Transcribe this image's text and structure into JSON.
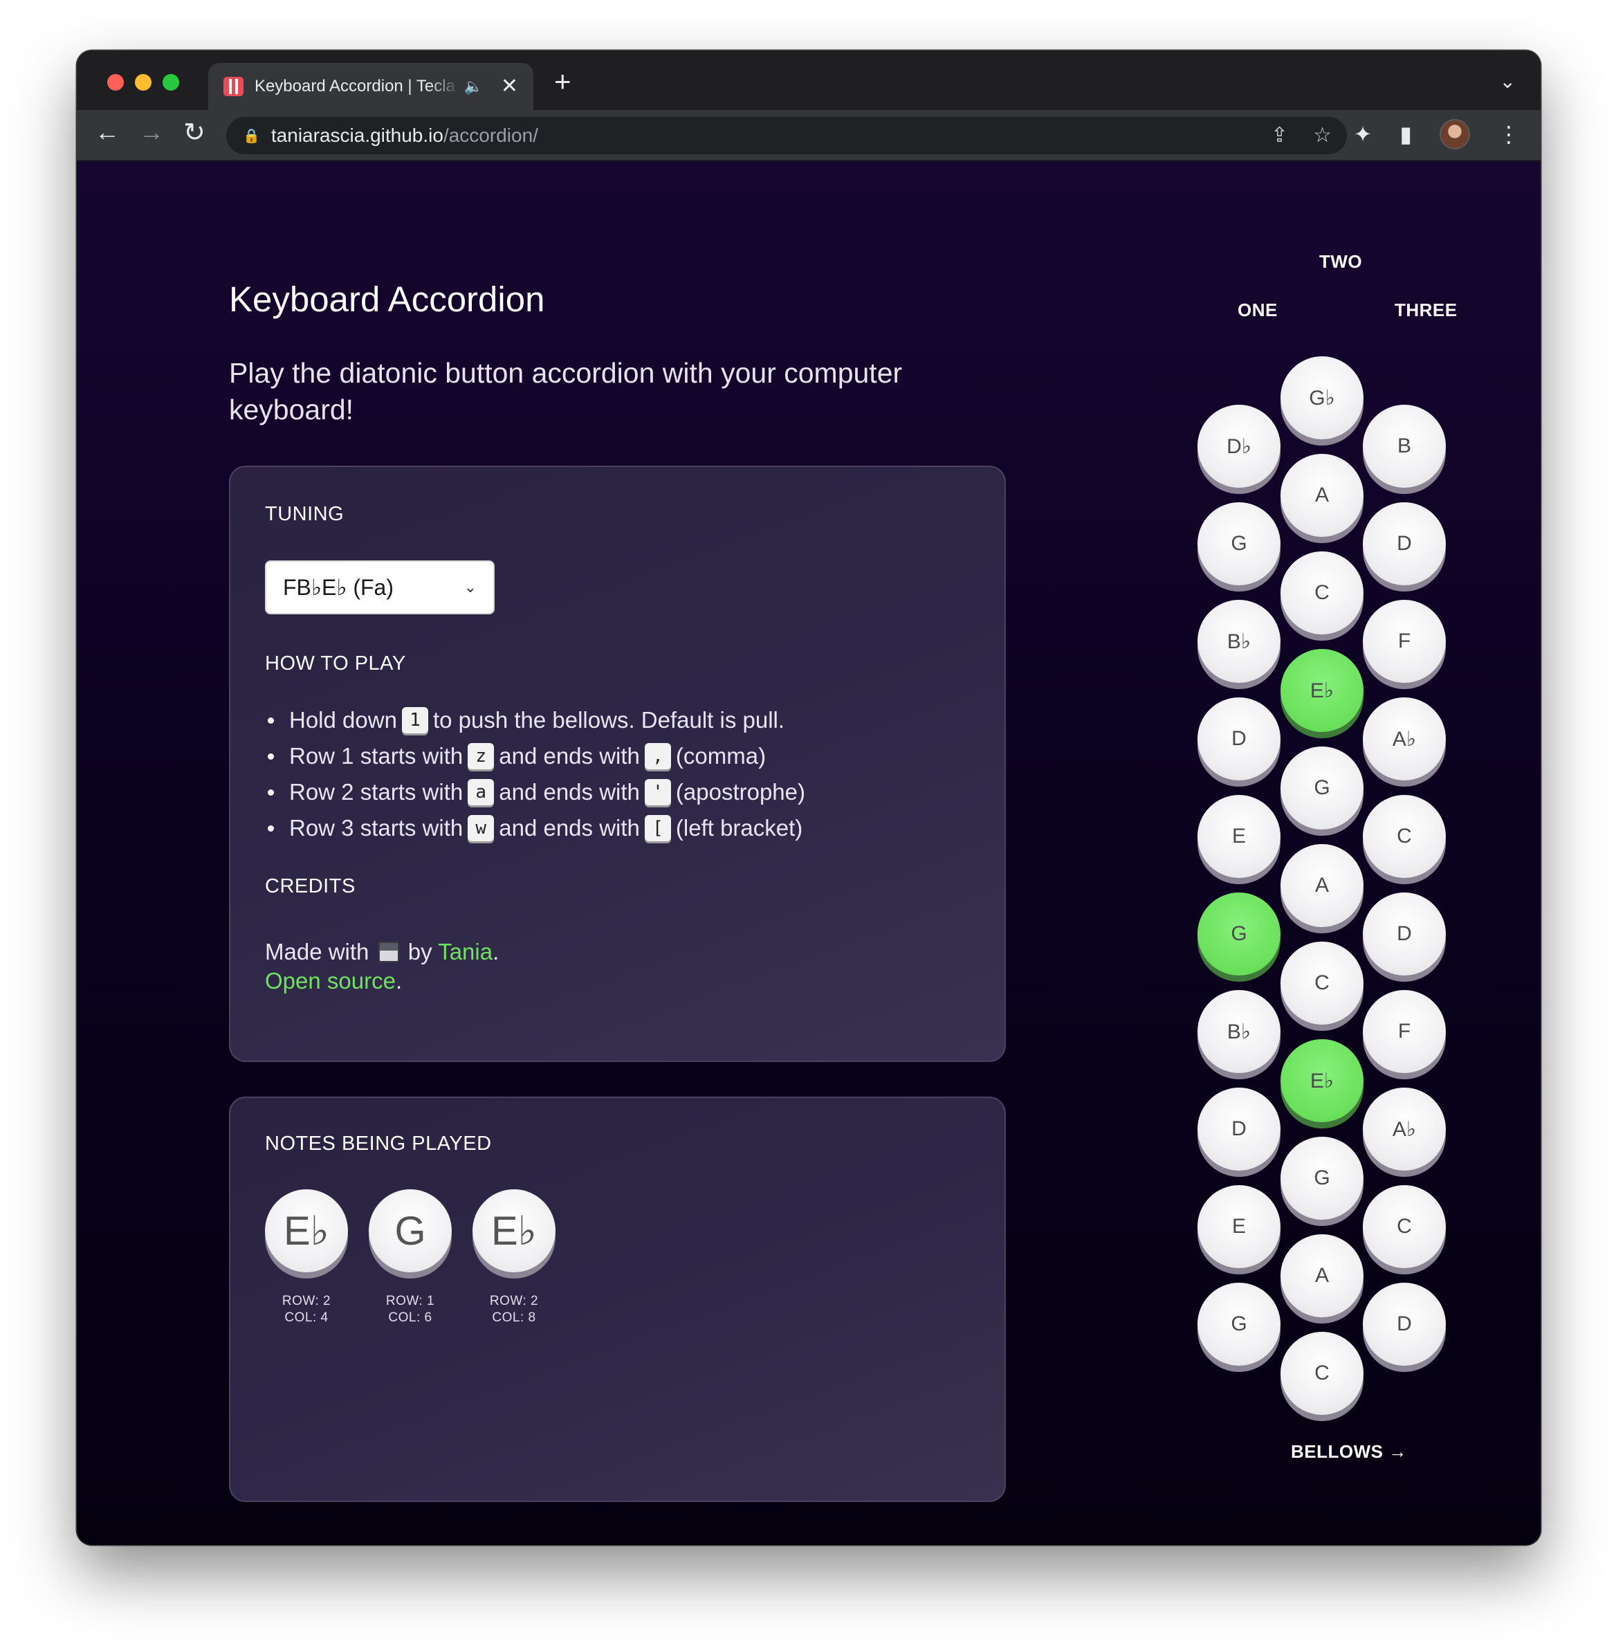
{
  "browser": {
    "tab_title": "Keyboard Accordion | Tecla",
    "tab_audio_icon": "speaker-icon",
    "tab_close": "✕",
    "new_tab": "+",
    "tab_list": "⌄",
    "url_host": "taniarascia.github.io",
    "url_path": "/accordion/"
  },
  "page": {
    "title": "Keyboard Accordion",
    "subtitle": "Play the diatonic button accordion with your computer keyboard!"
  },
  "tuning": {
    "heading": "TUNING",
    "selected": "FB♭E♭ (Fa)"
  },
  "how_to_play": {
    "heading": "HOW TO PLAY",
    "items": [
      {
        "before": "Hold down",
        "key": "1",
        "after": "to push the bellows. Default is pull."
      },
      {
        "before": "Row 1 starts with",
        "key": "z",
        "mid": "and ends with",
        "key2": ",",
        "after": "(comma)"
      },
      {
        "before": "Row 2 starts with",
        "key": "a",
        "mid": "and ends with",
        "key2": "'",
        "after": "(apostrophe)"
      },
      {
        "before": "Row 3 starts with",
        "key": "w",
        "mid": "and ends with",
        "key2": "[",
        "after": "(left bracket)"
      }
    ]
  },
  "credits": {
    "heading": "CREDITS",
    "made_with": "Made with",
    "by": "by",
    "author": "Tania",
    "period": ".",
    "open_source": "Open source",
    "period2": "."
  },
  "notes_being_played": {
    "heading": "NOTES BEING PLAYED",
    "notes": [
      {
        "note": "E♭",
        "row": "ROW: 2",
        "col": "COL: 4"
      },
      {
        "note": "G",
        "row": "ROW: 1",
        "col": "COL: 6"
      },
      {
        "note": "E♭",
        "row": "ROW: 2",
        "col": "COL: 8"
      }
    ]
  },
  "accordion": {
    "row_labels": {
      "one": "ONE",
      "two": "TWO",
      "three": "THREE"
    },
    "row1": [
      "D♭",
      "G",
      "B♭",
      "D",
      "E",
      "G",
      "B♭",
      "D",
      "E",
      "G"
    ],
    "row2": [
      "G♭",
      "A",
      "C",
      "E♭",
      "G",
      "A",
      "C",
      "E♭",
      "G",
      "A",
      "C"
    ],
    "row3": [
      "B",
      "D",
      "F",
      "A♭",
      "C",
      "D",
      "F",
      "A♭",
      "C",
      "D"
    ],
    "active": {
      "row1": [
        5
      ],
      "row2": [
        3,
        7
      ],
      "row3": []
    },
    "bellows_label": "BELLOWS →"
  },
  "colors": {
    "active_note": "#6ee35f",
    "link": "#6ee35f",
    "background": "#0a0018"
  }
}
